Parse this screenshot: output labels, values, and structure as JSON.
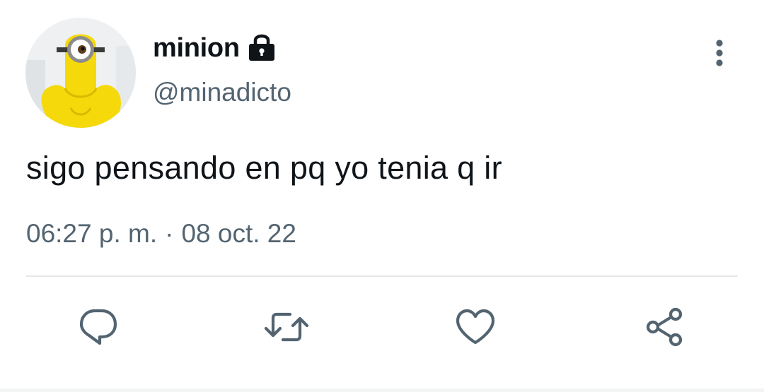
{
  "tweet": {
    "display_name": "minion",
    "handle": "@minadicto",
    "text": "sigo pensando en pq yo tenia q ir",
    "time": "06:27 p. m.",
    "separator": "·",
    "date": "08 oct. 22"
  },
  "icons": {
    "avatar": "minion-avatar",
    "protected": "lock-icon",
    "more": "more-vertical-icon",
    "reply": "reply-icon",
    "retweet": "retweet-icon",
    "like": "heart-icon",
    "share": "share-icon"
  },
  "colors": {
    "text_primary": "#0f1419",
    "text_secondary": "#536471",
    "icon": "#536471",
    "divider": "#e3e7ea",
    "avatar_yellow": "#f5d90a"
  }
}
